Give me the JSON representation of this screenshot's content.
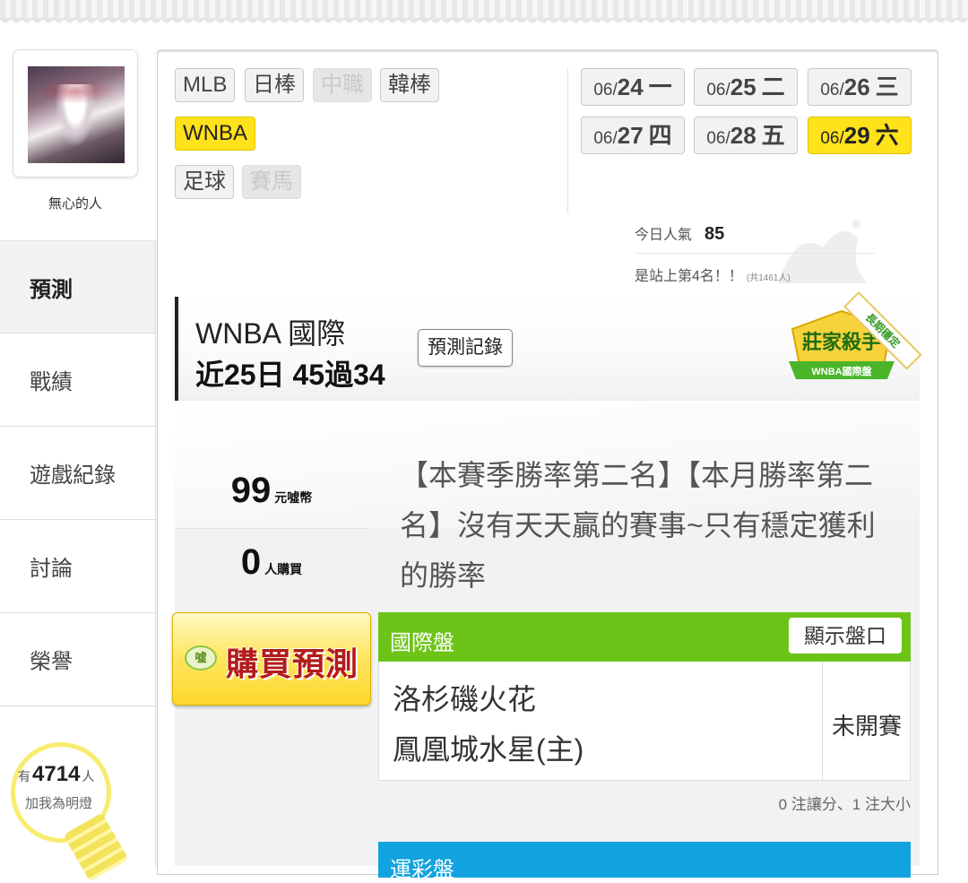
{
  "profile": {
    "username": "無心的人"
  },
  "sidebar": {
    "items": [
      {
        "label": "預測",
        "active": true
      },
      {
        "label": "戰績"
      },
      {
        "label": "遊戲紀錄"
      },
      {
        "label": "討論"
      },
      {
        "label": "榮譽"
      }
    ],
    "fans": {
      "prefix": "有",
      "count": "4714",
      "suffix": "人",
      "caption": "加我為明燈"
    }
  },
  "sports": {
    "row1": [
      "MLB",
      "日棒",
      "中職",
      "韓棒"
    ],
    "row2": [
      "WNBA"
    ],
    "row3": [
      "足球",
      "賽馬"
    ],
    "selected": "WNBA",
    "disabled": [
      "中職",
      "賽馬"
    ]
  },
  "dates": [
    {
      "md": "06/",
      "day": "24",
      "weekday": "一"
    },
    {
      "md": "06/",
      "day": "25",
      "weekday": "二"
    },
    {
      "md": "06/",
      "day": "26",
      "weekday": "三"
    },
    {
      "md": "06/",
      "day": "27",
      "weekday": "四"
    },
    {
      "md": "06/",
      "day": "28",
      "weekday": "五"
    },
    {
      "md": "06/",
      "day": "29",
      "weekday": "六",
      "selected": true
    }
  ],
  "popularity": {
    "label": "今日人氣",
    "value": "85",
    "rank_text": "是站上第4名！！",
    "total_text": "(共1461人)"
  },
  "header": {
    "title": "WNBA 國際",
    "record": "近25日 45過34",
    "record_button": "預測記錄",
    "badge_title": "莊家殺手",
    "badge_subtitle": "WNBA國際盤",
    "ribbon": "長期穩定"
  },
  "offer": {
    "price": "99",
    "price_unit": "元噓幣",
    "buyers": "0",
    "buyers_unit": "人購買",
    "buy_icon": "噓",
    "buy_label": "購買預測",
    "description": "【本賽季勝率第二名】【本月勝率第二名】沒有天天贏的賽事~只有穩定獲利的勝率"
  },
  "game": {
    "section_title": "國際盤",
    "show_odds_button": "顯示盤口",
    "away_team": "洛杉磯火花",
    "home_team": "鳳凰城水星(主)",
    "status": "未開賽",
    "bet_count": "0 注讓分、1 注大小",
    "header_color": "#6cc418"
  },
  "lottery": {
    "section_title": "運彩盤",
    "header_color": "#11a3e0"
  },
  "colors": {
    "selected_yellow": "#ffe21a",
    "buy_text": "#b31b1b"
  }
}
